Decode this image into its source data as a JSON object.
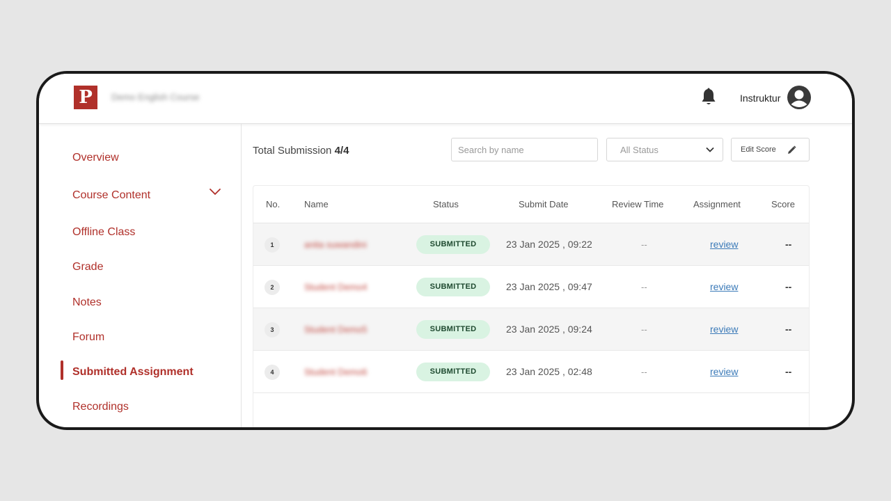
{
  "header": {
    "logo_letter": "P",
    "course_name": "Demo English Course",
    "user_label": "Instruktur"
  },
  "sidebar": {
    "items": [
      {
        "label": "Overview"
      },
      {
        "label": "Course Content"
      },
      {
        "label": "Offline Class"
      },
      {
        "label": "Grade"
      },
      {
        "label": "Notes"
      },
      {
        "label": "Forum"
      },
      {
        "label": "Submitted Assignment",
        "active": true
      },
      {
        "label": "Recordings"
      }
    ]
  },
  "main": {
    "total_label": "Total Submission",
    "total_value": "4/4",
    "search_placeholder": "Search by name",
    "status_filter": "All Status",
    "edit_score_label": "Edit Score"
  },
  "table": {
    "columns": [
      "No.",
      "Name",
      "Status",
      "Submit Date",
      "Review Time",
      "Assignment",
      "Score"
    ],
    "rows": [
      {
        "no": "1",
        "name": "anita suwandini",
        "status": "SUBMITTED",
        "submit_date": "23 Jan 2025 , 09:22",
        "review_time": "--",
        "assignment": "review",
        "score": "--"
      },
      {
        "no": "2",
        "name": "Student Demo4",
        "status": "SUBMITTED",
        "submit_date": "23 Jan 2025 , 09:47",
        "review_time": "--",
        "assignment": "review",
        "score": "--"
      },
      {
        "no": "3",
        "name": "Student Demo5",
        "status": "SUBMITTED",
        "submit_date": "23 Jan 2025 , 09:24",
        "review_time": "--",
        "assignment": "review",
        "score": "--"
      },
      {
        "no": "4",
        "name": "Student Demo6",
        "status": "SUBMITTED",
        "submit_date": "23 Jan 2025 , 02:48",
        "review_time": "--",
        "assignment": "review",
        "score": "--"
      }
    ]
  },
  "colors": {
    "brand": "#b0302a",
    "badge_bg": "#d9f3e2",
    "link": "#3b7ab8",
    "device_frame": "#1a1a1a"
  },
  "icons": {
    "notification": "bell-icon",
    "avatar": "user-avatar-icon",
    "expand": "chevron-down-icon",
    "edit": "pencil-icon"
  }
}
